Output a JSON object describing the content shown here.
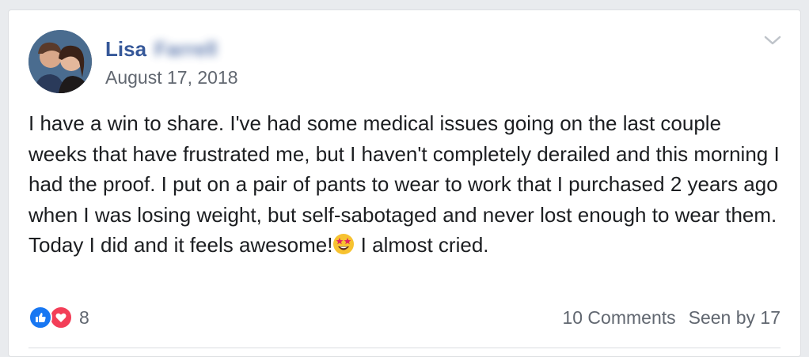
{
  "post": {
    "author_first": "Lisa",
    "author_last": "Farrell",
    "date": "August 17, 2018",
    "body_text": "I have a win to share. I've had some medical issues going on the last couple weeks that have frustrated me, but I haven't completely derailed and this morning I had the proof. I put on a pair of pants to wear to work that I purchased 2 years ago when I was losing weight, but self-sabotaged and never lost enough to wear them. Today I did and it feels awesome!",
    "body_end": " I almost cried.",
    "emoji_icon": "star-struck-emoji"
  },
  "reactions": {
    "icons": [
      "like-icon",
      "love-icon"
    ],
    "count": "8",
    "like_color": "#1877f2",
    "love_color": "#f33e58"
  },
  "footer": {
    "comments": "10 Comments",
    "seen_by": "Seen by 17"
  },
  "colors": {
    "author": "#365899",
    "meta": "#616770",
    "text": "#1c1e21"
  }
}
